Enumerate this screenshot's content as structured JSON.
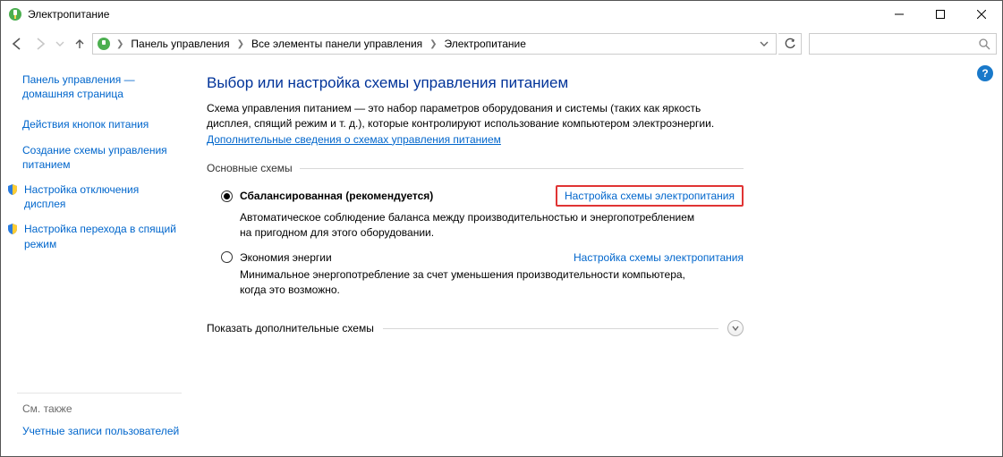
{
  "titlebar": {
    "title": "Электропитание"
  },
  "breadcrumbs": {
    "b0": "Панель управления",
    "b1": "Все элементы панели управления",
    "b2": "Электропитание"
  },
  "search": {
    "placeholder": ""
  },
  "sidebar": {
    "home": "Панель управления — домашняя страница",
    "l1": "Действия кнопок питания",
    "l2": "Создание схемы управления питанием",
    "l3": "Настройка отключения дисплея",
    "l4": "Настройка перехода в спящий режим",
    "see_also": "См. также",
    "l5": "Учетные записи пользователей"
  },
  "main": {
    "heading": "Выбор или настройка схемы управления питанием",
    "desc": "Схема управления питанием — это набор параметров оборудования и системы (таких как яркость дисплея, спящий режим и т. д.), которые контролируют использование компьютером электроэнергии.",
    "learn": "Дополнительные сведения о схемах управления питанием",
    "legend": "Основные схемы",
    "plan1": {
      "name": "Сбалансированная (рекомендуется)",
      "cfg": "Настройка схемы электропитания",
      "note": "Автоматическое соблюдение баланса между производительностью и энергопотреблением на пригодном для этого оборудовании."
    },
    "plan2": {
      "name": "Экономия энергии",
      "cfg": "Настройка схемы электропитания",
      "note": "Минимальное энергопотребление за счет уменьшения производительности компьютера, когда это возможно."
    },
    "showmore": "Показать дополнительные схемы"
  }
}
